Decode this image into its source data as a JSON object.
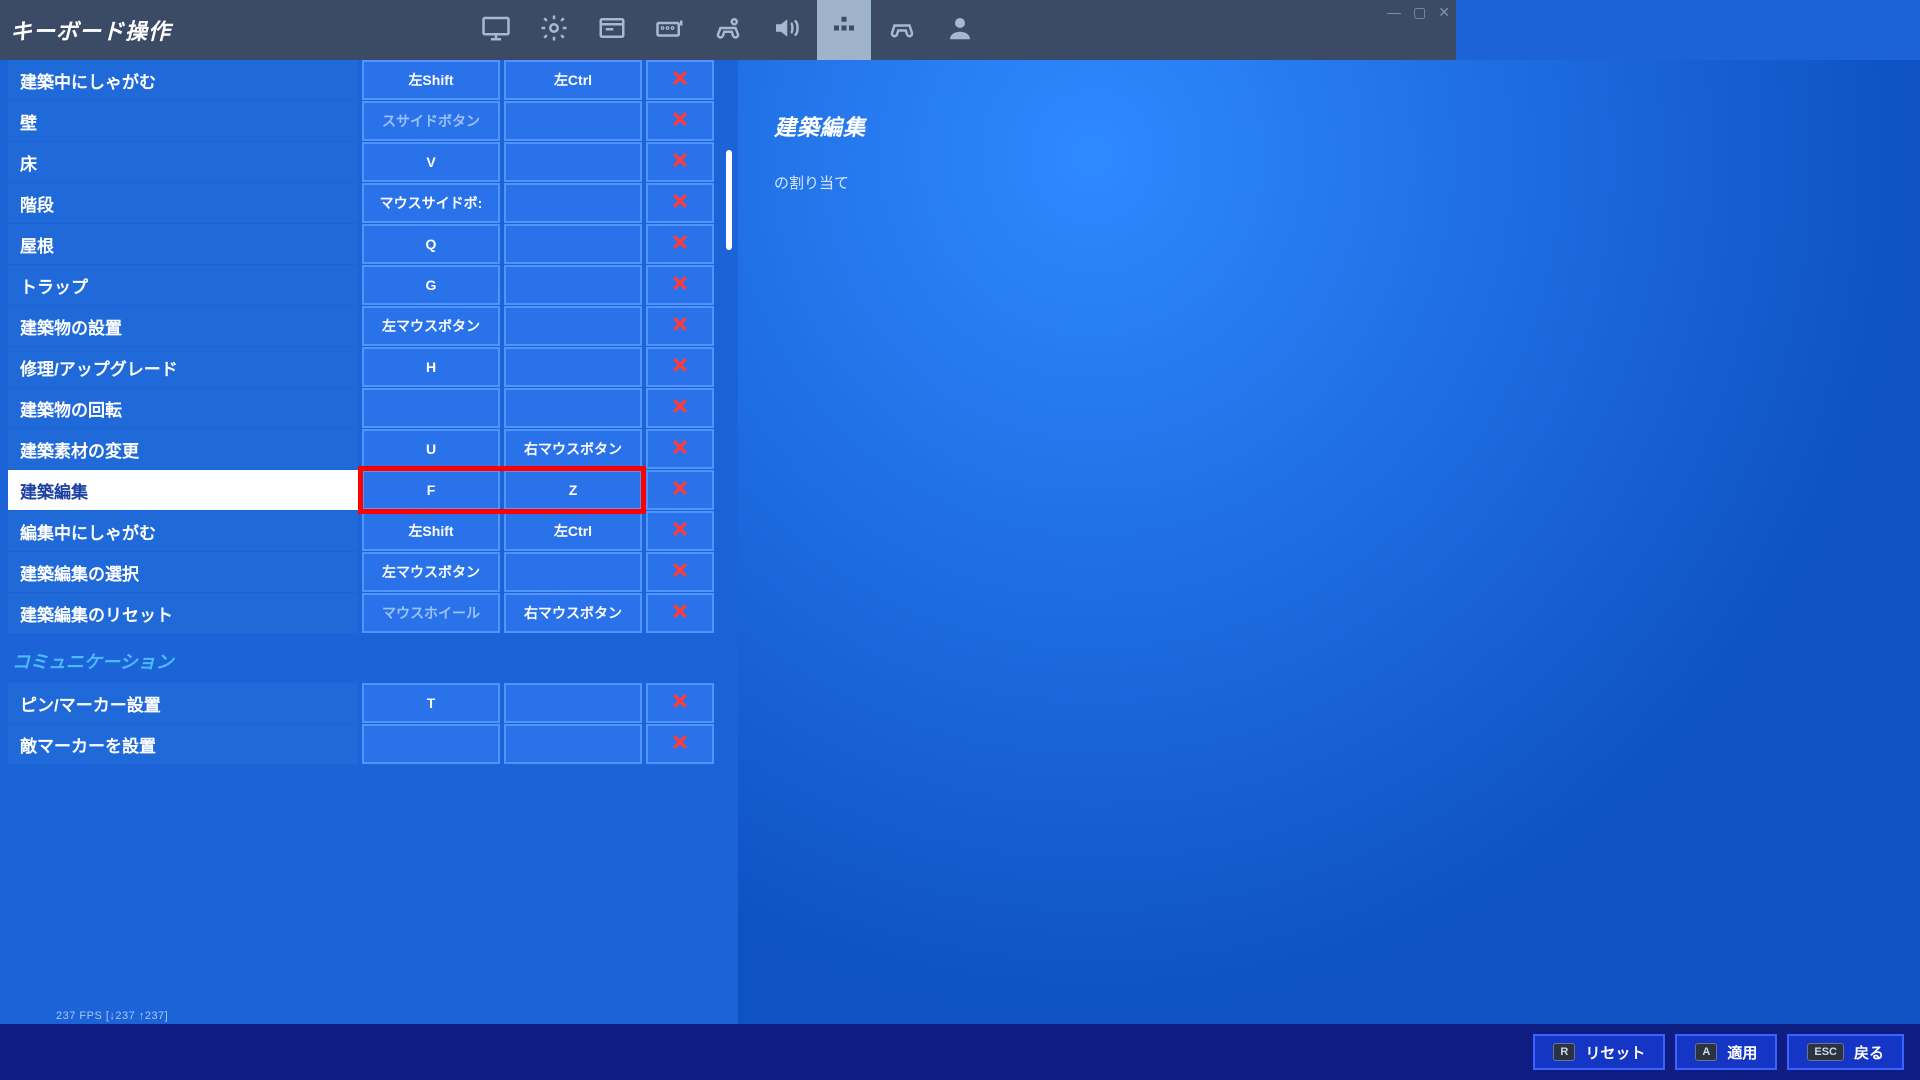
{
  "header": {
    "title": "キーボード操作"
  },
  "tabs": [
    {
      "name": "display-icon"
    },
    {
      "name": "gear-icon"
    },
    {
      "name": "language-icon"
    },
    {
      "name": "keyboard-icon"
    },
    {
      "name": "controller-wrench-icon"
    },
    {
      "name": "speaker-icon"
    },
    {
      "name": "arrows-icon",
      "active": true
    },
    {
      "name": "gamepad-icon"
    },
    {
      "name": "person-icon"
    }
  ],
  "detail": {
    "title": "建築編集",
    "desc": "の割り当て"
  },
  "bindings": [
    {
      "label": "建築中にしゃがむ",
      "k1": "左Shift",
      "k2": "左Ctrl"
    },
    {
      "label": "壁",
      "k1": "スサイドボタン",
      "k2": "",
      "dim1": true
    },
    {
      "label": "床",
      "k1": "V",
      "k2": ""
    },
    {
      "label": "階段",
      "k1": "マウスサイドボ:",
      "k2": ""
    },
    {
      "label": "屋根",
      "k1": "Q",
      "k2": ""
    },
    {
      "label": "トラップ",
      "k1": "G",
      "k2": ""
    },
    {
      "label": "建築物の設置",
      "k1": "左マウスボタン",
      "k2": ""
    },
    {
      "label": "修理/アップグレード",
      "k1": "H",
      "k2": ""
    },
    {
      "label": "建築物の回転",
      "k1": "",
      "k2": ""
    },
    {
      "label": "建築素材の変更",
      "k1": "U",
      "k2": "右マウスボタン"
    },
    {
      "label": "建築編集",
      "k1": "F",
      "k2": "Z",
      "selected": true,
      "highlight": true
    },
    {
      "label": "編集中にしゃがむ",
      "k1": "左Shift",
      "k2": "左Ctrl"
    },
    {
      "label": "建築編集の選択",
      "k1": "左マウスボタン",
      "k2": ""
    },
    {
      "label": "建築編集のリセット",
      "k1": "マウスホイール",
      "k2": "右マウスボタン",
      "dim1": true
    }
  ],
  "section": "コミュニケーション",
  "bindings2": [
    {
      "label": "ピン/マーカー設置",
      "k1": "T",
      "k2": ""
    },
    {
      "label": "敵マーカーを設置",
      "k1": "",
      "k2": ""
    }
  ],
  "footer": {
    "reset": {
      "key": "R",
      "label": "リセット"
    },
    "apply": {
      "key": "A",
      "label": "適用"
    },
    "back": {
      "key": "ESC",
      "label": "戻る"
    }
  },
  "fps": "237 FPS [↓237 ↑237]"
}
